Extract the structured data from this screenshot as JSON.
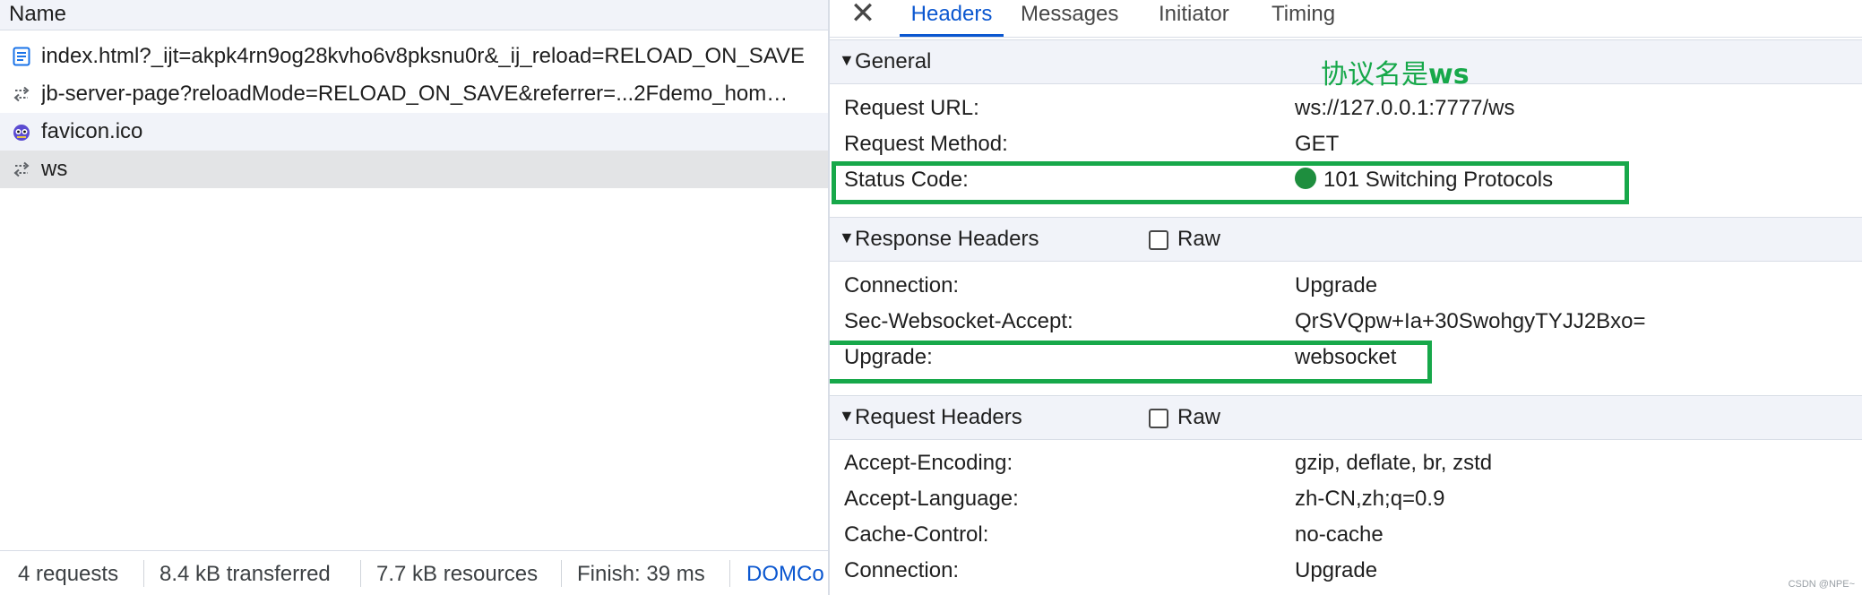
{
  "left": {
    "column_header": "Name",
    "requests": [
      {
        "name": "index.html?_ijt=akpk4rn9og28kvho6v8pksnu0r&_ij_reload=RELOAD_ON_SAVE",
        "icon": "document-icon"
      },
      {
        "name": "jb-server-page?reloadMode=RELOAD_ON_SAVE&referrer=...2Fdemo_hom…",
        "icon": "websocket-icon"
      },
      {
        "name": "favicon.ico",
        "icon": "favicon-image-icon"
      },
      {
        "name": "ws",
        "icon": "websocket-icon"
      }
    ],
    "status_bar": {
      "requests": "4 requests",
      "transferred": "8.4 kB transferred",
      "resources": "7.7 kB resources",
      "finish": "Finish: 39 ms",
      "domcontent": "DOMCo"
    }
  },
  "right": {
    "close_label": "✕",
    "tabs": [
      "Headers",
      "Messages",
      "Initiator",
      "Timing"
    ],
    "active_tab": "Headers",
    "annotation_prefix": "协议名是",
    "annotation_bold": "ws",
    "general": {
      "title": "General",
      "rows": [
        {
          "key": "Request URL:",
          "value": "ws://127.0.0.1:7777/ws"
        },
        {
          "key": "Request Method:",
          "value": "GET"
        },
        {
          "key": "Status Code:",
          "value": "101 Switching Protocols"
        }
      ]
    },
    "response_headers": {
      "title": "Response Headers",
      "raw_label": "Raw",
      "rows": [
        {
          "key": "Connection:",
          "value": "Upgrade"
        },
        {
          "key": "Sec-Websocket-Accept:",
          "value": "QrSVQpw+Ia+30SwohgyTYJJ2Bxo="
        },
        {
          "key": "Upgrade:",
          "value": "websocket"
        }
      ]
    },
    "request_headers": {
      "title": "Request Headers",
      "raw_label": "Raw",
      "rows": [
        {
          "key": "Accept-Encoding:",
          "value": "gzip, deflate, br, zstd"
        },
        {
          "key": "Accept-Language:",
          "value": "zh-CN,zh;q=0.9"
        },
        {
          "key": "Cache-Control:",
          "value": "no-cache"
        },
        {
          "key": "Connection:",
          "value": "Upgrade"
        }
      ]
    }
  },
  "watermark": "CSDN @NPE~",
  "colors": {
    "accent": "#0b57d0",
    "highlight": "#17a84a",
    "status_ok": "#1e8e3e"
  }
}
